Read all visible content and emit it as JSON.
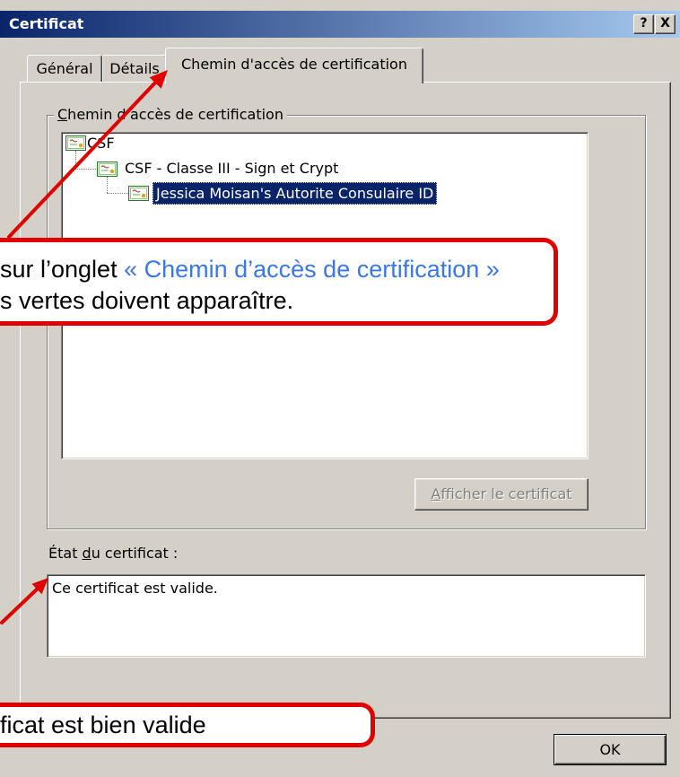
{
  "window": {
    "title": "Certificat",
    "buttons": [
      {
        "icon": "help-icon",
        "glyph": "?"
      },
      {
        "icon": "close-icon",
        "glyph": "X"
      }
    ]
  },
  "tabs": [
    {
      "label": "Général",
      "selected": false
    },
    {
      "label": "Détails",
      "selected": false
    },
    {
      "label": "Chemin d'accès de certification",
      "selected": true
    }
  ],
  "path_group": {
    "label": "Chemin d'accès de certification",
    "tree": {
      "icon": "certificate-icon",
      "items": [
        {
          "label": "CSF",
          "level": 0,
          "selected": false
        },
        {
          "label": "CSF - Classe III - Sign et Crypt",
          "level": 1,
          "selected": false
        },
        {
          "label": "Jessica Moisan's Autorite Consulaire ID",
          "level": 2,
          "selected": true
        }
      ]
    },
    "view_button": {
      "label": "Afficher le certificat",
      "enabled": false
    }
  },
  "status": {
    "label": "État du certificat :",
    "text": "Ce certificat est valide."
  },
  "ok_button": {
    "label": "OK"
  },
  "callouts": [
    {
      "line1_text": "sur l’onglet ",
      "line1_highlight": "« Chemin d’accès de certification »",
      "line2_text": "s vertes doivent apparaître."
    },
    {
      "line1_text": "ficat est bien valide"
    }
  ],
  "colors": {
    "dialog_bg": "#d4d0c8",
    "title_start": "#0a246a",
    "title_end": "#a6caf0",
    "selection": "#0a246a",
    "callout_border": "#e00000",
    "callout_highlight": "#3b78e7",
    "arrow": "#e00000",
    "disabled_text": "#808080"
  }
}
